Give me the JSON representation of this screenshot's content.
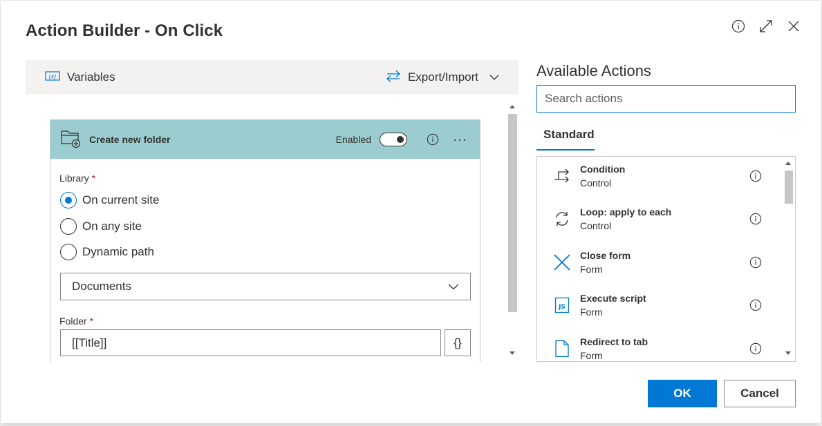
{
  "dialog": {
    "title": "Action Builder - On Click"
  },
  "toolbar": {
    "variables_label": "Variables",
    "export_import_label": "Export/Import"
  },
  "action_card": {
    "title": "Create new folder",
    "enabled_label": "Enabled",
    "enabled": true,
    "library_label": "Library",
    "required_mark": "*",
    "library_options": [
      {
        "label": "On current site",
        "checked": true
      },
      {
        "label": "On any site",
        "checked": false
      },
      {
        "label": "Dynamic path",
        "checked": false
      }
    ],
    "library_selected": "Documents",
    "folder_label": "Folder",
    "folder_value": "[[Title]]",
    "brace_button_label": "{}"
  },
  "available_actions": {
    "title": "Available Actions",
    "search_placeholder": "Search actions",
    "tabs": [
      {
        "label": "Standard",
        "active": true
      }
    ],
    "items": [
      {
        "name": "Condition",
        "category": "Control",
        "icon": "condition-icon"
      },
      {
        "name": "Loop: apply to each",
        "category": "Control",
        "icon": "loop-icon"
      },
      {
        "name": "Close form",
        "category": "Form",
        "icon": "close-form-icon"
      },
      {
        "name": "Execute script",
        "category": "Form",
        "icon": "script-icon"
      },
      {
        "name": "Redirect to tab",
        "category": "Form",
        "icon": "document-icon"
      }
    ]
  },
  "footer": {
    "ok_label": "OK",
    "cancel_label": "Cancel"
  },
  "colors": {
    "accent": "#0078d4",
    "card_header": "#9bcdd0",
    "required": "#a4262c"
  }
}
